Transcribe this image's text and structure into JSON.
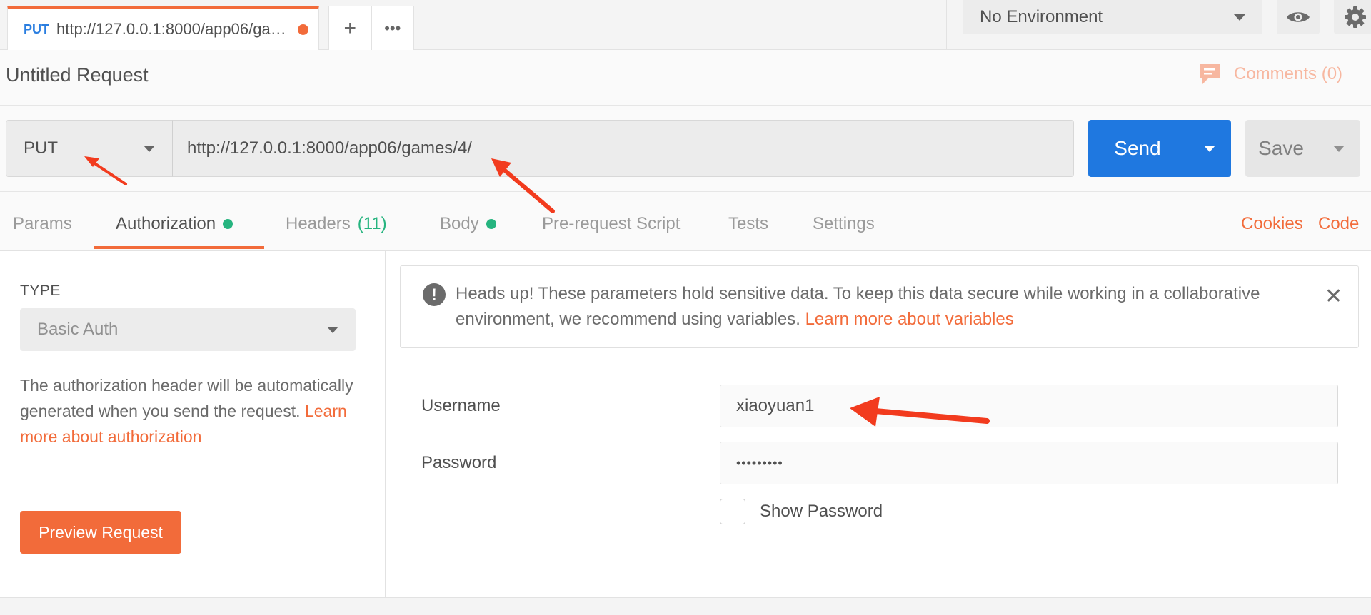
{
  "tabbar": {
    "tab_method": "PUT",
    "tab_url": "http://127.0.0.1:8000/app06/ga…",
    "add_tab": "+",
    "more_tabs": "•••",
    "environment": "No Environment"
  },
  "request": {
    "title": "Untitled Request",
    "comments": "Comments (0)",
    "method": "PUT",
    "url": "http://127.0.0.1:8000/app06/games/4/",
    "send_label": "Send",
    "save_label": "Save"
  },
  "subtabs": {
    "params": "Params",
    "authorization": "Authorization",
    "headers": "Headers",
    "headers_count": "(11)",
    "body": "Body",
    "prerequest": "Pre-request Script",
    "tests": "Tests",
    "settings": "Settings",
    "cookies": "Cookies",
    "code": "Code"
  },
  "auth": {
    "type_label": "TYPE",
    "type_value": "Basic Auth",
    "desc_text": "The authorization header will be automatically generated when you send the request. ",
    "desc_link": "Learn more about authorization",
    "preview_label": "Preview Request",
    "alert_text": "Heads up! These parameters hold sensitive data. To keep this data secure while working in a collaborative environment, we recommend using variables. ",
    "alert_link": "Learn more about variables",
    "alert_icon": "!",
    "alert_close": "✕",
    "username_label": "Username",
    "username_value": "xiaoyuan1",
    "password_label": "Password",
    "password_value": "•••••••••",
    "show_password_label": "Show Password"
  },
  "colors": {
    "accent": "#f26b3a",
    "send_blue": "#1f78e0",
    "status_green": "#26b47f",
    "annotation_red": "#f23b1e"
  }
}
